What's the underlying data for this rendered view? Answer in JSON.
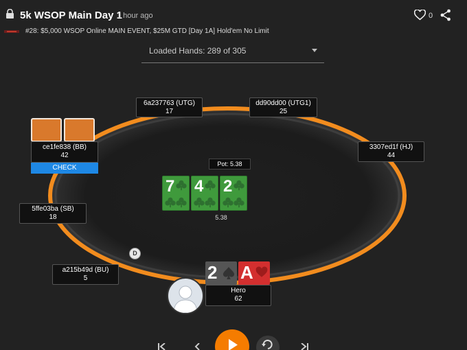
{
  "header": {
    "title": "5k WSOP Main Day 1",
    "time_ago": "1 hour ago",
    "likes": "0",
    "subtitle": "#28: $5,000 WSOP Online MAIN EVENT, $25M GTD [Day 1A] Hold'em No Limit"
  },
  "hands_select": {
    "label": "Loaded Hands: 289 of 305"
  },
  "seats": {
    "utg": {
      "name": "6a237763 (UTG)",
      "stack": "17"
    },
    "utg1": {
      "name": "dd90dd00 (UTG1)",
      "stack": "25"
    },
    "hj": {
      "name": "3307ed1f (HJ)",
      "stack": "44"
    },
    "bb": {
      "name": "ce1fe838 (BB)",
      "stack": "42",
      "action": "CHECK"
    },
    "sb": {
      "name": "5ffe03ba (SB)",
      "stack": "18"
    },
    "bu": {
      "name": "a215b49d (BU)",
      "stack": "5"
    },
    "hero": {
      "name": "Hero",
      "stack": "62"
    }
  },
  "pot": {
    "label": "Pot: 5.38",
    "amount": "5.38"
  },
  "board": [
    {
      "rank": "7",
      "suit": "clubs"
    },
    {
      "rank": "4",
      "suit": "clubs"
    },
    {
      "rank": "2",
      "suit": "clubs"
    }
  ],
  "hero_cards": [
    {
      "rank": "2",
      "suit": "spades",
      "color": "#555555"
    },
    {
      "rank": "A",
      "suit": "hearts",
      "color": "#d32f2f"
    }
  ],
  "dealer_button": "D",
  "colors": {
    "table_rail": "#f28c1e",
    "check_button": "#1e88e5",
    "board_card": "#3f9a3c",
    "play_button": "#f57c00",
    "card_back": "#d9792c"
  }
}
